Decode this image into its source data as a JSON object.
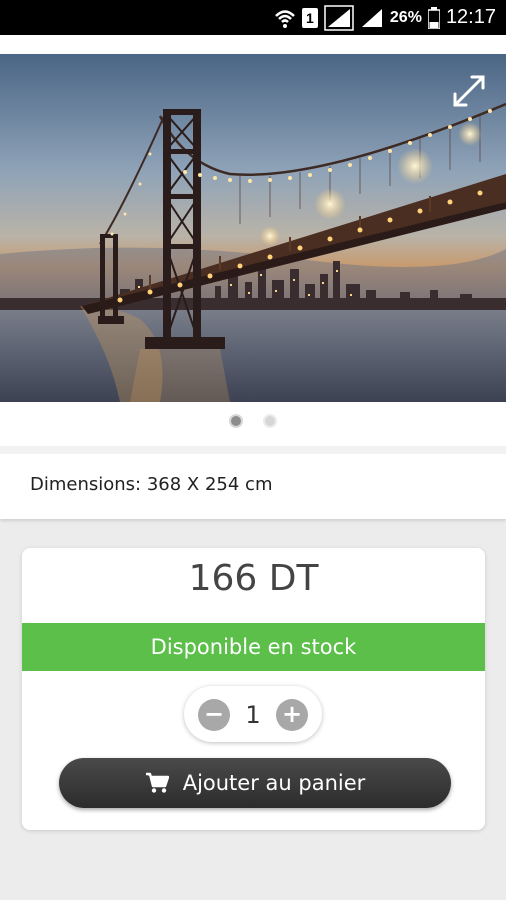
{
  "status_bar": {
    "sim_label": "1",
    "battery_percent": "26%",
    "time": "12:17"
  },
  "product": {
    "image_dots": {
      "count": 2,
      "active_index": 0
    },
    "dimensions_text": "Dimensions: 368 X 254 cm",
    "price": "166 DT",
    "stock_status": "Disponible en stock",
    "quantity": "1",
    "minus_label": "−",
    "plus_label": "+",
    "add_to_cart_label": "Ajouter au panier"
  },
  "colors": {
    "stock_green": "#5bbf4a",
    "cart_button": "#2c2c2c"
  },
  "icons": [
    "wifi-icon",
    "sim-icon",
    "signal-icon",
    "battery-icon",
    "expand-icon",
    "cart-icon"
  ]
}
